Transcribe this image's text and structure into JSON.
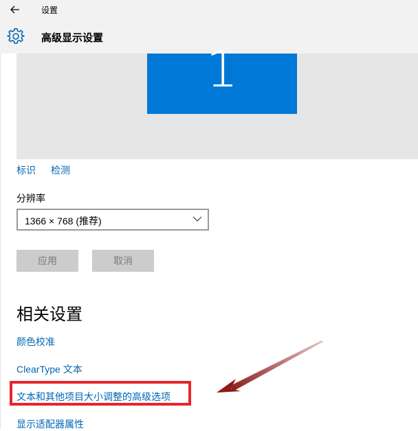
{
  "window": {
    "title": "设置"
  },
  "header": {
    "title": "高级显示设置"
  },
  "display": {
    "monitor_number": "1",
    "monitor_color": "#0078d7",
    "identify_link": "标识",
    "detect_link": "检测"
  },
  "resolution": {
    "label": "分辨率",
    "selected": "1366 × 768 (推荐)"
  },
  "buttons": {
    "apply": "应用",
    "cancel": "取消"
  },
  "related": {
    "heading": "相关设置",
    "links": [
      "颜色校准",
      "ClearType 文本",
      "文本和其他项目大小调整的高级选项",
      "显示适配器属性"
    ]
  },
  "annotation": {
    "highlight_color": "#e8242a",
    "arrow_color": "#8b1a1a"
  },
  "colors": {
    "link": "#0066b4",
    "header_bg": "#f2f2f2",
    "preview_bg": "#e6e6e6"
  }
}
